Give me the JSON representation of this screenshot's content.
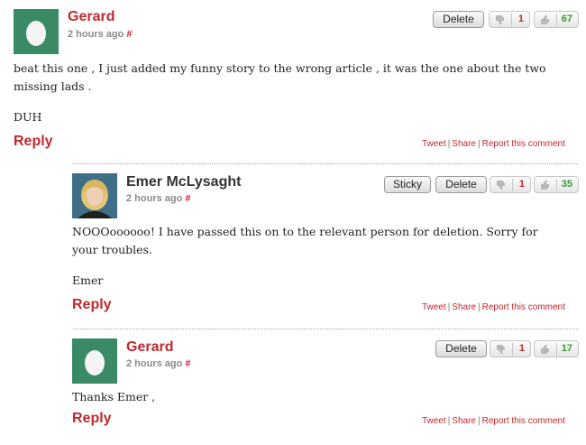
{
  "colors": {
    "accent": "#c0282d",
    "up_count": "#3a9a2e",
    "avatar_green": "#3a8a66"
  },
  "comments": [
    {
      "author": "Gerard",
      "author_color": "#c0282d",
      "time": "2 hours ago",
      "permalink": "#",
      "paragraphs": [
        "beat this one , I just added my funny story to the wrong article , it was the one about the two missing lads .",
        "DUH"
      ],
      "reply_label": "Reply",
      "actions": {
        "tweet": "Tweet",
        "share": "Share",
        "report": "Report this comment"
      },
      "buttons": {
        "delete": "Delete"
      },
      "votes": {
        "down": "1",
        "up": "67"
      },
      "avatar_icon": "egg-avatar-icon"
    },
    {
      "author": "Emer McLysaght",
      "author_color": "#333333",
      "time": "2 hours ago",
      "permalink": "#",
      "paragraphs": [
        "NOOOoooooo! I have passed this on to the relevant person for deletion. Sorry for your troubles.",
        "Emer"
      ],
      "reply_label": "Reply",
      "actions": {
        "tweet": "Tweet",
        "share": "Share",
        "report": "Report this comment"
      },
      "buttons": {
        "sticky": "Sticky",
        "delete": "Delete"
      },
      "votes": {
        "down": "1",
        "up": "35"
      },
      "avatar_icon": "user-photo-avatar"
    },
    {
      "author": "Gerard",
      "author_color": "#c0282d",
      "time": "2 hours ago",
      "permalink": "#",
      "paragraphs": [
        "Thanks Emer ,"
      ],
      "reply_label": "Reply",
      "actions": {
        "tweet": "Tweet",
        "share": "Share",
        "report": "Report this comment"
      },
      "buttons": {
        "delete": "Delete"
      },
      "votes": {
        "down": "1",
        "up": "17"
      },
      "avatar_icon": "egg-avatar-icon"
    }
  ]
}
